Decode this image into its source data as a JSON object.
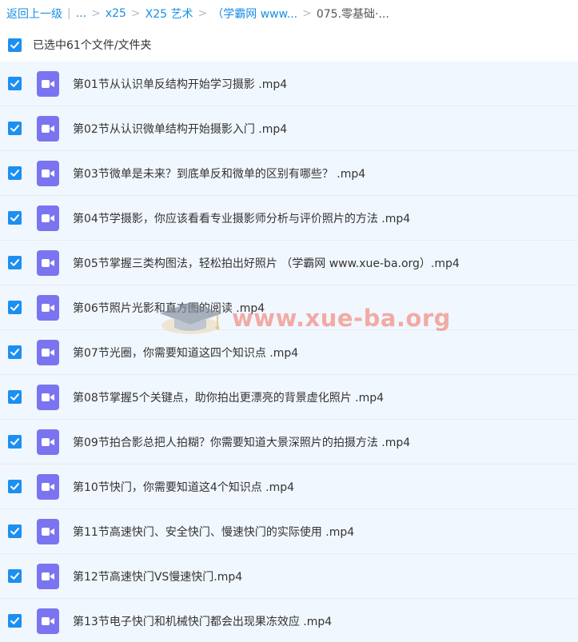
{
  "breadcrumb": {
    "back": "返回上一级",
    "divider": "|",
    "items": [
      "...",
      "x25",
      "X25 艺术",
      "（学霸网 www...",
      "075.零基础·..."
    ],
    "separator": ">"
  },
  "selection": {
    "label": "已选中61个文件/文件夹"
  },
  "files": [
    {
      "name": "第01节从认识单反结构开始学习摄影 .mp4"
    },
    {
      "name": "第02节从认识微单结构开始摄影入门 .mp4"
    },
    {
      "name": "第03节微单是未来？到底单反和微单的区别有哪些？ .mp4"
    },
    {
      "name": "第04节学摄影，你应该看看专业摄影师分析与评价照片的方法 .mp4"
    },
    {
      "name": "第05节掌握三类构图法，轻松拍出好照片 （学霸网 www.xue-ba.org）.mp4"
    },
    {
      "name": "第06节照片光影和直方图的阅读 .mp4"
    },
    {
      "name": "第07节光圈，你需要知道这四个知识点 .mp4"
    },
    {
      "name": "第08节掌握5个关键点，助你拍出更漂亮的背景虚化照片 .mp4"
    },
    {
      "name": "第09节拍合影总把人拍糊？你需要知道大景深照片的拍摄方法 .mp4"
    },
    {
      "name": "第10节快门，你需要知道这4个知识点 .mp4"
    },
    {
      "name": "第11节高速快门、安全快门、慢速快门的实际使用 .mp4"
    },
    {
      "name": "第12节高速快门VS慢速快门.mp4"
    },
    {
      "name": "第13节电子快门和机械快门都会出现果冻效应 .mp4"
    }
  ],
  "watermark": {
    "text": "www.xue-ba.org"
  },
  "icons": {
    "checkbox": "check-icon",
    "file": "video-file-icon",
    "watermark": "graduation-cap-icon"
  },
  "colors": {
    "link": "#1a8fe3",
    "checkbox": "#1d8ff0",
    "row_bg": "#f1f7fe",
    "file_icon": "#7b74f0"
  }
}
